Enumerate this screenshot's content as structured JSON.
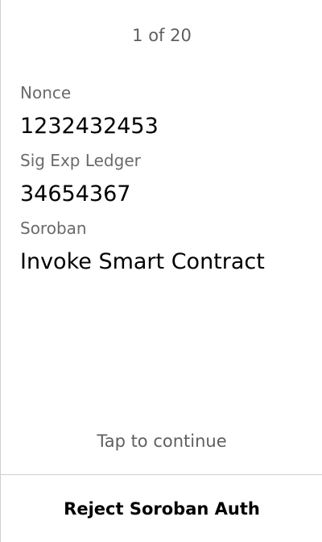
{
  "pager": {
    "text": "1 of 20"
  },
  "fields": [
    {
      "label": "Nonce",
      "value": "1232432453"
    },
    {
      "label": "Sig Exp Ledger",
      "value": "34654367"
    },
    {
      "label": "Soroban",
      "value": "Invoke Smart Contract"
    }
  ],
  "hint": {
    "text": "Tap to continue"
  },
  "actions": {
    "reject_label": "Reject Soroban Auth"
  }
}
